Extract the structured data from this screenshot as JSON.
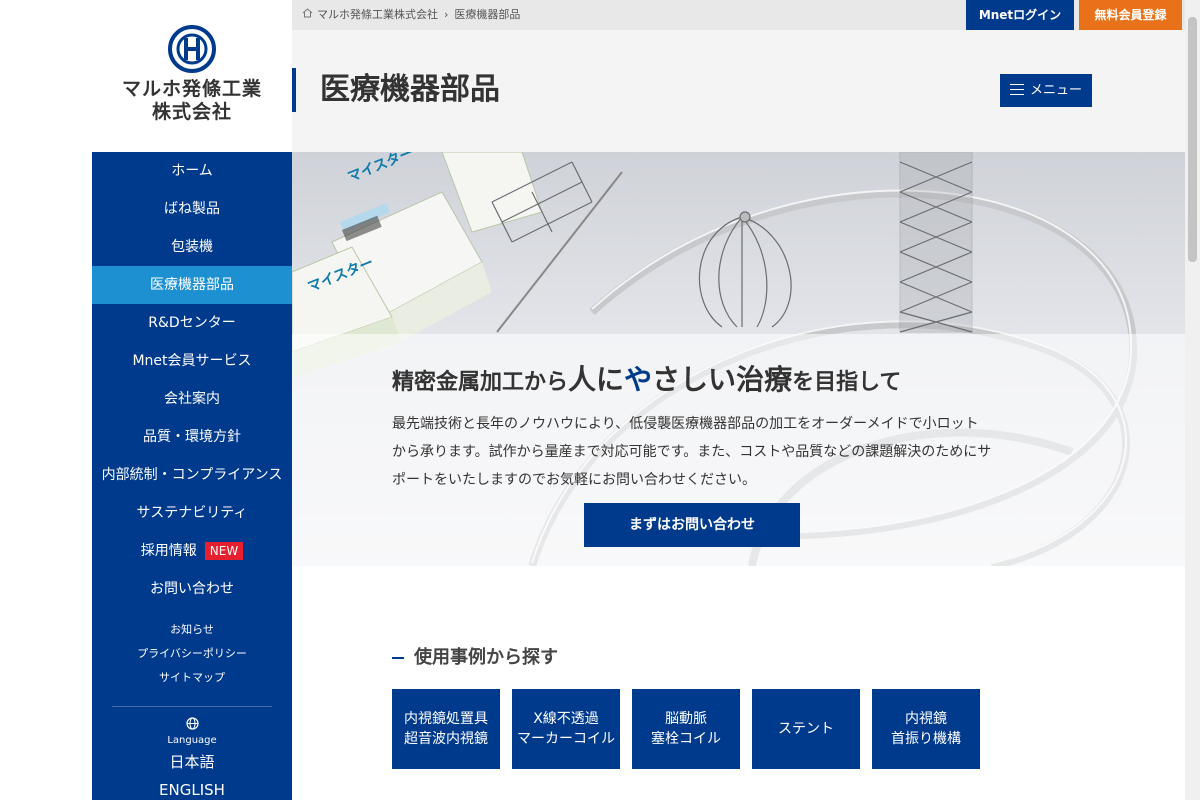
{
  "logo": {
    "line1": "マルホ発條工業",
    "line2": "株式会社"
  },
  "topbar": {
    "breadcrumb": [
      "マルホ発條工業株式会社",
      "医療機器部品"
    ],
    "login_label": "Mnetログイン",
    "register_label": "無料会員登録"
  },
  "sidebar": {
    "items": [
      {
        "label": "ホーム"
      },
      {
        "label": "ばね製品"
      },
      {
        "label": "包装機"
      },
      {
        "label": "医療機器部品"
      },
      {
        "label": "R&Dセンター"
      },
      {
        "label": "Mnet会員サービス"
      },
      {
        "label": "会社案内"
      },
      {
        "label": "品質・環境方針"
      },
      {
        "label": "内部統制・コンプライアンス"
      },
      {
        "label": "サステナビリティ"
      },
      {
        "label": "採用情報"
      },
      {
        "label": "お問い合わせ"
      }
    ],
    "new_badge": "NEW",
    "sub_links": [
      "お知らせ",
      "プライバシーポリシー",
      "サイトマップ"
    ],
    "language_label": "Language",
    "languages": [
      "日本語",
      "ENGLISH"
    ]
  },
  "page": {
    "title": "医療機器部品",
    "menu_label": "メニュー"
  },
  "hero": {
    "headline_a": "精密金属加工から",
    "headline_b": "人に",
    "headline_c": "や",
    "headline_d": "さしい",
    "headline_e": "治療",
    "headline_f": "を目指して",
    "body": "最先端技術と長年のノウハウにより、低侵襲医療機器部品の加工をオーダーメイドで小ロットから承ります。試作から量産まで対応可能です。また、コストや品質などの課題解決のためにサポートをいたしますのでお気軽にお問い合わせください。",
    "cta_label": "まずはお問い合わせ",
    "box_label": "マイスター"
  },
  "usecases": {
    "heading": "使用事例から探す",
    "cards": [
      {
        "line1": "内視鏡処置具",
        "line2": "超音波内視鏡"
      },
      {
        "line1": "X線不透過",
        "line2": "マーカーコイル"
      },
      {
        "line1": "脳動脈",
        "line2": "塞栓コイル"
      },
      {
        "line1": "ステント",
        "line2": ""
      },
      {
        "line1": "内視鏡",
        "line2": "首振り機構"
      }
    ]
  },
  "colors": {
    "primary": "#003a8c",
    "active": "#1c90d0",
    "accent_orange": "#e8711a",
    "badge_red": "#e6202e"
  }
}
